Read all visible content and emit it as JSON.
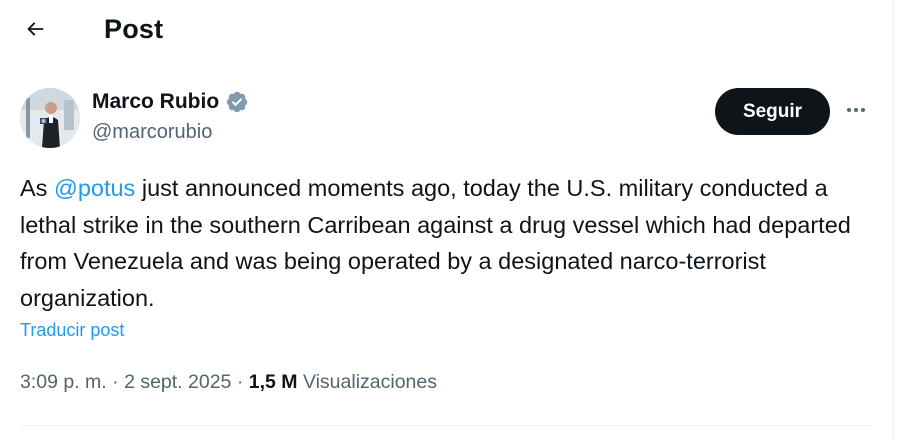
{
  "header": {
    "title": "Post",
    "back_icon": "arrow-left-icon"
  },
  "author": {
    "name": "Marco Rubio",
    "handle": "@marcorubio",
    "verified_icon": "verified-badge-icon",
    "verified_color": "#829aab"
  },
  "actions": {
    "follow_label": "Seguir",
    "more_icon": "more-horizontal-icon"
  },
  "post": {
    "text_before": "As ",
    "mention": "@potus",
    "text_after": " just announced moments ago, today the U.S. military conducted a lethal strike in the southern Carribean against a drug vessel which had departed from Venezuela and was being operated by a designated narco-terrorist organization.",
    "translate_label": "Traducir post"
  },
  "meta": {
    "time": "3:09 p. m.",
    "separator_1": " · ",
    "date": "2 sept. 2025",
    "separator_2": " · ",
    "views_count": "1,5 M",
    "views_label": " Visualizaciones"
  },
  "colors": {
    "accent": "#1d9bf0",
    "text_primary": "#0f1419",
    "text_secondary": "#536471",
    "button_bg": "#0f1419"
  }
}
